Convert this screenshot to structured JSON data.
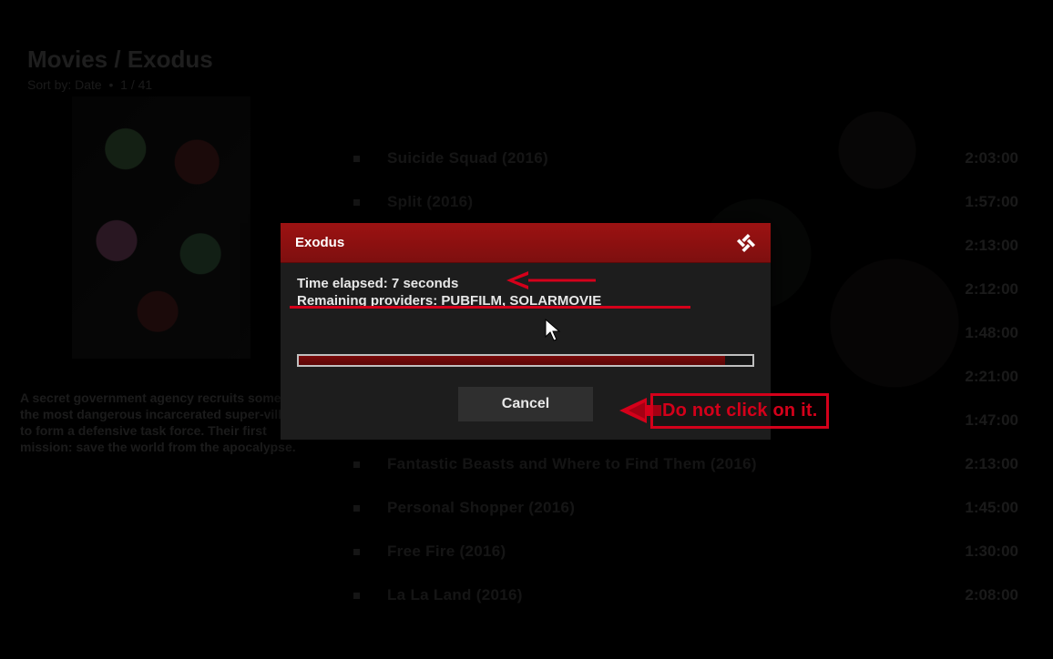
{
  "breadcrumb": {
    "title": "Movies / Exodus",
    "sort_label": "Sort by: Date",
    "sep": "•",
    "position": "1 / 41"
  },
  "synopsis": "A secret government agency recruits some of the most dangerous incarcerated super-villains to form a defensive task force. Their first mission: save the world from the apocalypse.",
  "list": [
    {
      "title": "Suicide Squad (2016)",
      "duration": "2:03:00"
    },
    {
      "title": "Split (2016)",
      "duration": "1:57:00"
    },
    {
      "title": "",
      "duration": "2:13:00"
    },
    {
      "title": "",
      "duration": "2:12:00"
    },
    {
      "title": "",
      "duration": "1:48:00"
    },
    {
      "title": "",
      "duration": "2:21:00"
    },
    {
      "title": "",
      "duration": "1:47:00"
    },
    {
      "title": "Fantastic Beasts and Where to Find Them (2016)",
      "duration": "2:13:00"
    },
    {
      "title": "Personal Shopper (2016)",
      "duration": "1:45:00"
    },
    {
      "title": "Free Fire (2016)",
      "duration": "1:30:00"
    },
    {
      "title": "La La Land (2016)",
      "duration": "2:08:00"
    }
  ],
  "dialog": {
    "title": "Exodus",
    "line1": "Time elapsed: 7 seconds",
    "line2": "Remaining providers: PUBFILM, SOLARMOVIE",
    "progress_pct": 94,
    "cancel": "Cancel"
  },
  "annotation": {
    "callout": "Do not click on it.",
    "color": "#d4001a"
  }
}
